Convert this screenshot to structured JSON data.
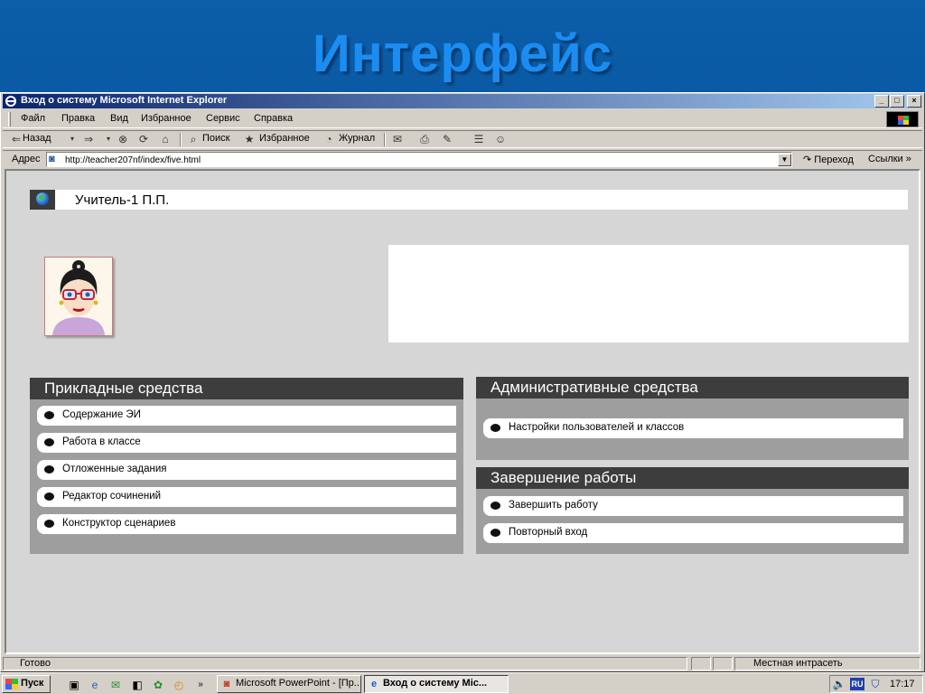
{
  "slide": {
    "title": "Интерфейс"
  },
  "window": {
    "title": "Вход о систему   Microsoft Internet Explorer",
    "buttons": {
      "minimize": "_",
      "maximize": "□",
      "close": "×"
    }
  },
  "menu": [
    "Файл",
    "Правка",
    "Вид",
    "Избранное",
    "Сервис",
    "Справка"
  ],
  "toolbar": {
    "back": "Назад",
    "search": "Поиск",
    "favorites": "Избранное",
    "history": "Журнал"
  },
  "address": {
    "label": "Адрес",
    "url": "http://teacher207nf/index/five.html",
    "go": "Переход",
    "links": "Ссылки"
  },
  "page": {
    "user_name": "Учитель-1  П.П.",
    "applied_tools": {
      "title": "Прикладные средства",
      "items": [
        "Содержание ЭИ",
        "Работа в классе",
        "Отложенные задания",
        "Редактор сочинений",
        "Конструктор сценариев"
      ]
    },
    "admin_tools": {
      "title": "Административные средства",
      "items": [
        "Настройки пользователей и классов"
      ]
    },
    "finish": {
      "title": "Завершение работы",
      "items": [
        "Завершить работу",
        "Повторный вход"
      ]
    }
  },
  "statusbar": {
    "status": "Готово",
    "zone": "Местная интрасеть"
  },
  "taskbar": {
    "start": "Пуск",
    "tasks": [
      "Microsoft PowerPoint - [Пр...",
      "Вход о систему   Mic..."
    ],
    "lang": "RU",
    "time": "17:17"
  },
  "colors": {
    "slide_bg": "#0a5aa6",
    "title": "#1b8df2",
    "panel_head": "#3d3d3d",
    "panel_body": "#9e9e9e",
    "content_bg": "#d6d6d6"
  }
}
